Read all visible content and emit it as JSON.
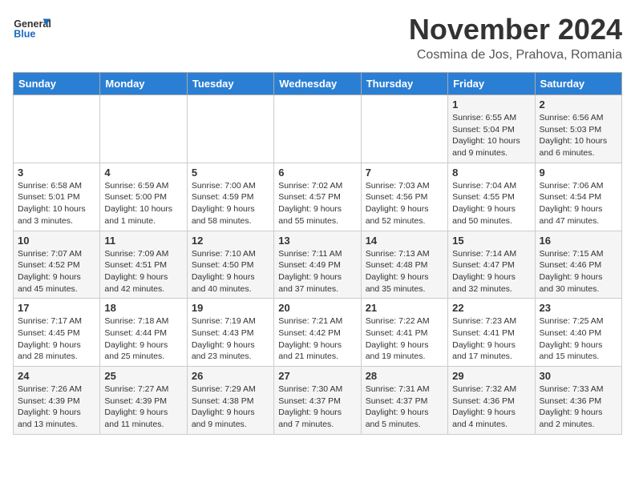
{
  "logo": {
    "text_general": "General",
    "text_blue": "Blue"
  },
  "header": {
    "month_year": "November 2024",
    "location": "Cosmina de Jos, Prahova, Romania"
  },
  "days_of_week": [
    "Sunday",
    "Monday",
    "Tuesday",
    "Wednesday",
    "Thursday",
    "Friday",
    "Saturday"
  ],
  "weeks": [
    [
      {
        "day": "",
        "info": ""
      },
      {
        "day": "",
        "info": ""
      },
      {
        "day": "",
        "info": ""
      },
      {
        "day": "",
        "info": ""
      },
      {
        "day": "",
        "info": ""
      },
      {
        "day": "1",
        "info": "Sunrise: 6:55 AM\nSunset: 5:04 PM\nDaylight: 10 hours and 9 minutes."
      },
      {
        "day": "2",
        "info": "Sunrise: 6:56 AM\nSunset: 5:03 PM\nDaylight: 10 hours and 6 minutes."
      }
    ],
    [
      {
        "day": "3",
        "info": "Sunrise: 6:58 AM\nSunset: 5:01 PM\nDaylight: 10 hours and 3 minutes."
      },
      {
        "day": "4",
        "info": "Sunrise: 6:59 AM\nSunset: 5:00 PM\nDaylight: 10 hours and 1 minute."
      },
      {
        "day": "5",
        "info": "Sunrise: 7:00 AM\nSunset: 4:59 PM\nDaylight: 9 hours and 58 minutes."
      },
      {
        "day": "6",
        "info": "Sunrise: 7:02 AM\nSunset: 4:57 PM\nDaylight: 9 hours and 55 minutes."
      },
      {
        "day": "7",
        "info": "Sunrise: 7:03 AM\nSunset: 4:56 PM\nDaylight: 9 hours and 52 minutes."
      },
      {
        "day": "8",
        "info": "Sunrise: 7:04 AM\nSunset: 4:55 PM\nDaylight: 9 hours and 50 minutes."
      },
      {
        "day": "9",
        "info": "Sunrise: 7:06 AM\nSunset: 4:54 PM\nDaylight: 9 hours and 47 minutes."
      }
    ],
    [
      {
        "day": "10",
        "info": "Sunrise: 7:07 AM\nSunset: 4:52 PM\nDaylight: 9 hours and 45 minutes."
      },
      {
        "day": "11",
        "info": "Sunrise: 7:09 AM\nSunset: 4:51 PM\nDaylight: 9 hours and 42 minutes."
      },
      {
        "day": "12",
        "info": "Sunrise: 7:10 AM\nSunset: 4:50 PM\nDaylight: 9 hours and 40 minutes."
      },
      {
        "day": "13",
        "info": "Sunrise: 7:11 AM\nSunset: 4:49 PM\nDaylight: 9 hours and 37 minutes."
      },
      {
        "day": "14",
        "info": "Sunrise: 7:13 AM\nSunset: 4:48 PM\nDaylight: 9 hours and 35 minutes."
      },
      {
        "day": "15",
        "info": "Sunrise: 7:14 AM\nSunset: 4:47 PM\nDaylight: 9 hours and 32 minutes."
      },
      {
        "day": "16",
        "info": "Sunrise: 7:15 AM\nSunset: 4:46 PM\nDaylight: 9 hours and 30 minutes."
      }
    ],
    [
      {
        "day": "17",
        "info": "Sunrise: 7:17 AM\nSunset: 4:45 PM\nDaylight: 9 hours and 28 minutes."
      },
      {
        "day": "18",
        "info": "Sunrise: 7:18 AM\nSunset: 4:44 PM\nDaylight: 9 hours and 25 minutes."
      },
      {
        "day": "19",
        "info": "Sunrise: 7:19 AM\nSunset: 4:43 PM\nDaylight: 9 hours and 23 minutes."
      },
      {
        "day": "20",
        "info": "Sunrise: 7:21 AM\nSunset: 4:42 PM\nDaylight: 9 hours and 21 minutes."
      },
      {
        "day": "21",
        "info": "Sunrise: 7:22 AM\nSunset: 4:41 PM\nDaylight: 9 hours and 19 minutes."
      },
      {
        "day": "22",
        "info": "Sunrise: 7:23 AM\nSunset: 4:41 PM\nDaylight: 9 hours and 17 minutes."
      },
      {
        "day": "23",
        "info": "Sunrise: 7:25 AM\nSunset: 4:40 PM\nDaylight: 9 hours and 15 minutes."
      }
    ],
    [
      {
        "day": "24",
        "info": "Sunrise: 7:26 AM\nSunset: 4:39 PM\nDaylight: 9 hours and 13 minutes."
      },
      {
        "day": "25",
        "info": "Sunrise: 7:27 AM\nSunset: 4:39 PM\nDaylight: 9 hours and 11 minutes."
      },
      {
        "day": "26",
        "info": "Sunrise: 7:29 AM\nSunset: 4:38 PM\nDaylight: 9 hours and 9 minutes."
      },
      {
        "day": "27",
        "info": "Sunrise: 7:30 AM\nSunset: 4:37 PM\nDaylight: 9 hours and 7 minutes."
      },
      {
        "day": "28",
        "info": "Sunrise: 7:31 AM\nSunset: 4:37 PM\nDaylight: 9 hours and 5 minutes."
      },
      {
        "day": "29",
        "info": "Sunrise: 7:32 AM\nSunset: 4:36 PM\nDaylight: 9 hours and 4 minutes."
      },
      {
        "day": "30",
        "info": "Sunrise: 7:33 AM\nSunset: 4:36 PM\nDaylight: 9 hours and 2 minutes."
      }
    ]
  ]
}
